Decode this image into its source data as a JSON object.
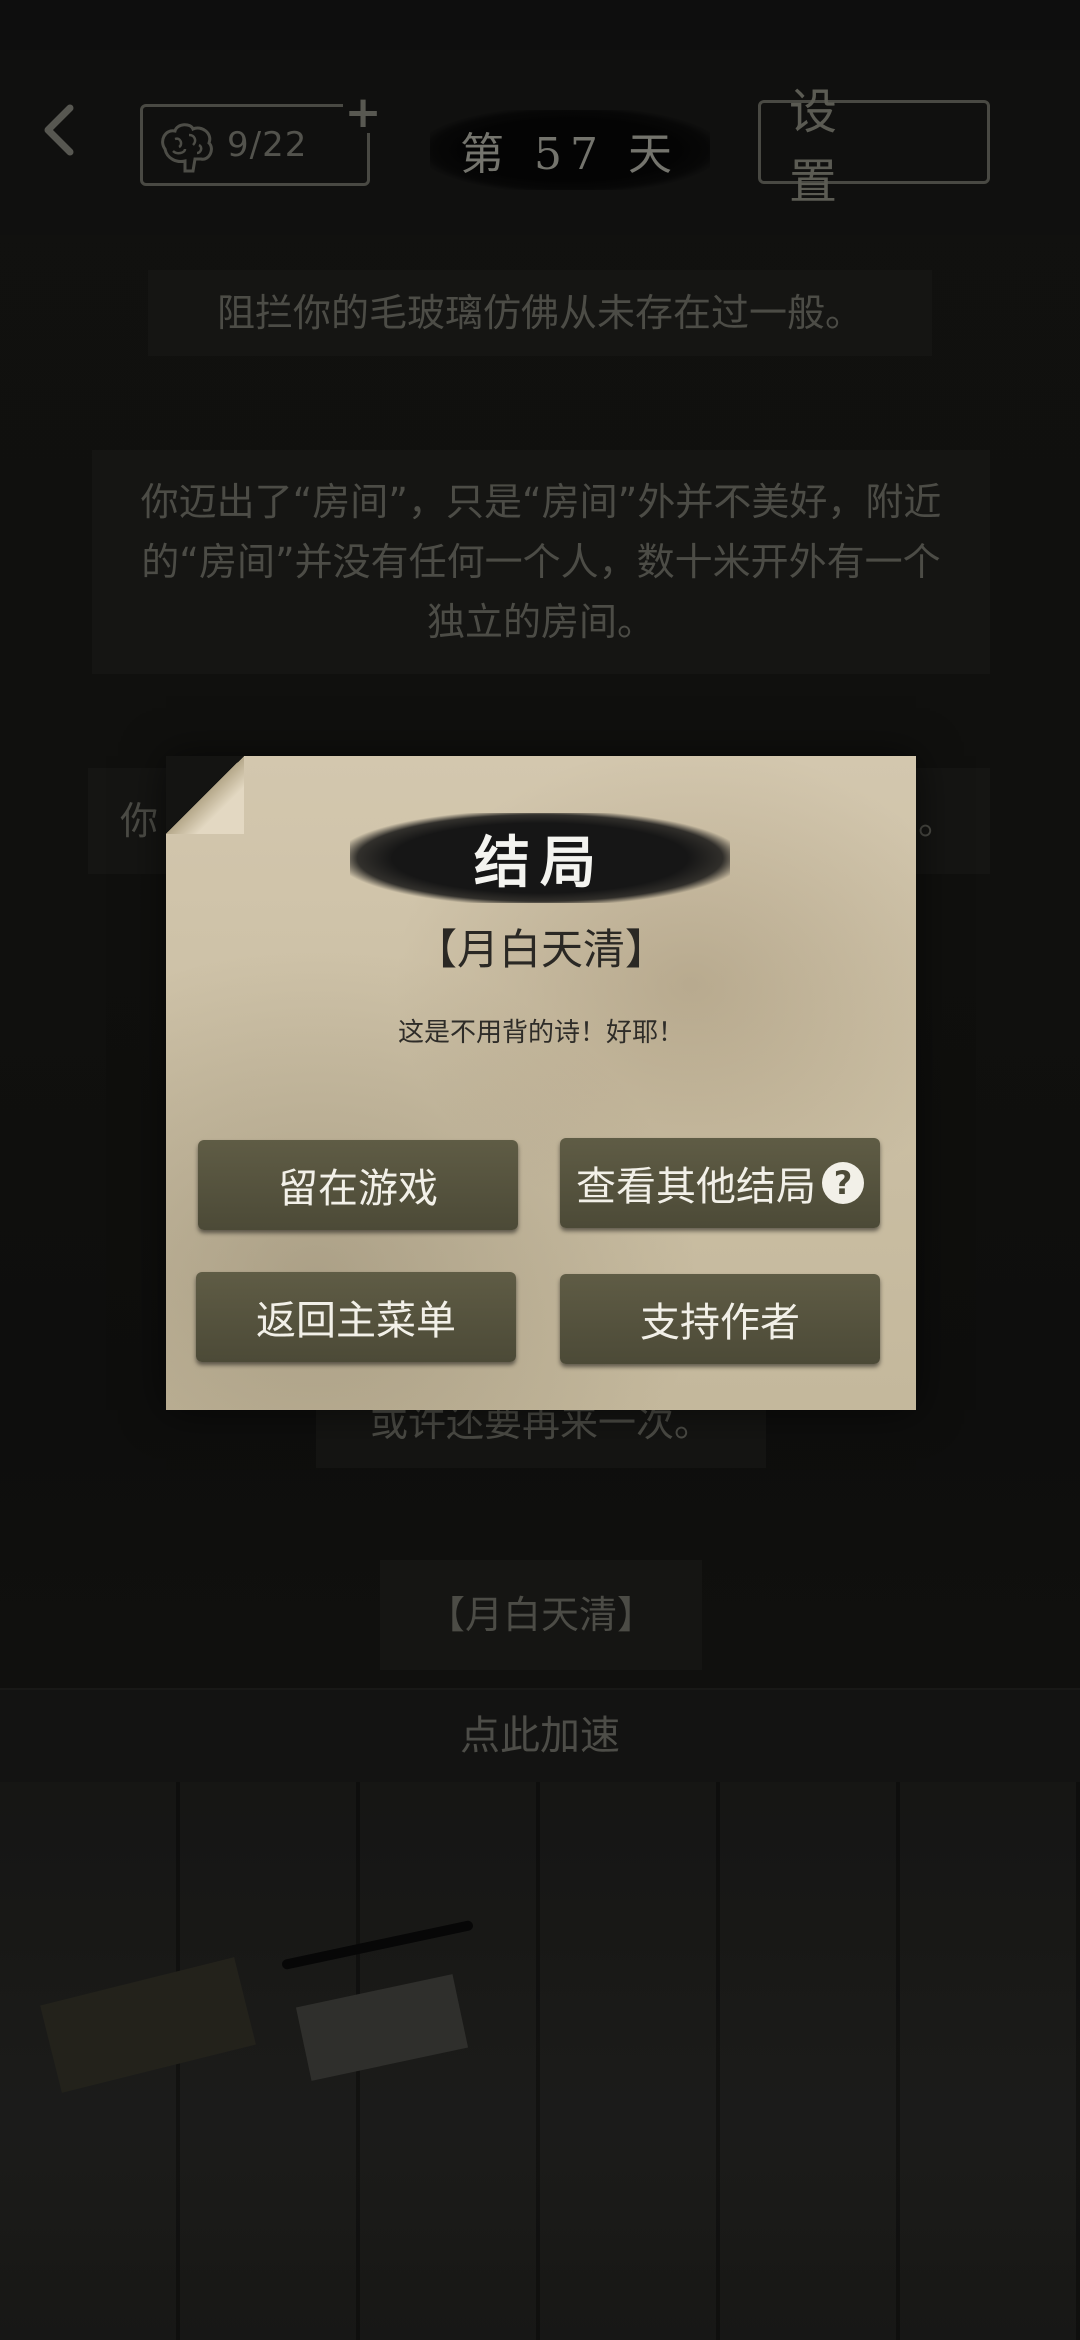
{
  "header": {
    "brain_count": "9/22",
    "add_label": "+",
    "day_label": "第 57 天",
    "settings_label": "设 置"
  },
  "story": {
    "p1": "阻拦你的毛玻璃仿佛从未存在过一般。",
    "p2_line1": "你迈出了“房间”，只是“房间”外并不美好，附近",
    "p2_line2": "的“房间”并没有任何一个人，数十米开外有一个",
    "p2_line3": "独立的房间。",
    "p3_head": "你",
    "p3_tail": "。",
    "p4": "或许还要再来一次。",
    "p5": "【月白天清】",
    "speed_label": "点此加速"
  },
  "dialog": {
    "title": "结局",
    "ending_name": "【月白天清】",
    "ending_desc": "这是不用背的诗！好耶！",
    "stay_label": "留在游戏",
    "other_endings_label": "查看其他结局",
    "help_symbol": "?",
    "main_menu_label": "返回主菜单",
    "support_label": "支持作者"
  }
}
